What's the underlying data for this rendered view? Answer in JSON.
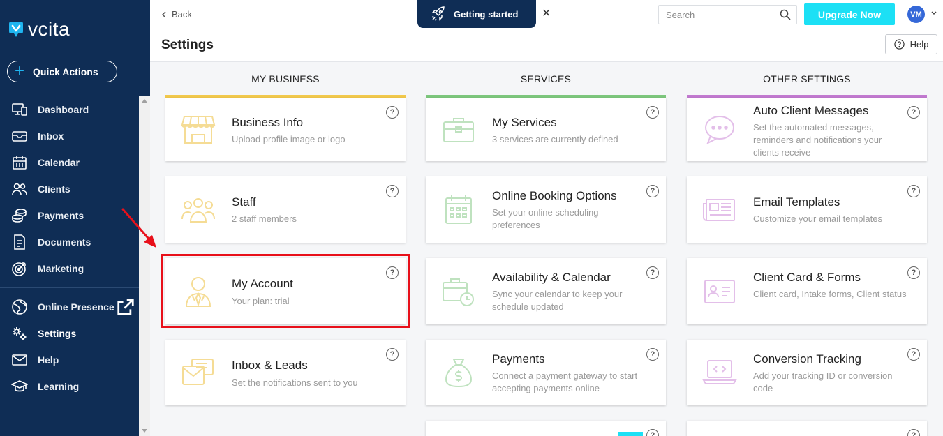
{
  "brand": {
    "name": "vcita",
    "accent": "#1fb5f0",
    "sidebar_bg": "#0f2d55"
  },
  "quick_actions": {
    "label": "Quick Actions"
  },
  "nav": {
    "items": [
      {
        "label": "Dashboard",
        "icon": "dashboard-icon"
      },
      {
        "label": "Inbox",
        "icon": "inbox-icon"
      },
      {
        "label": "Calendar",
        "icon": "calendar-icon"
      },
      {
        "label": "Clients",
        "icon": "clients-icon"
      },
      {
        "label": "Payments",
        "icon": "payments-icon"
      },
      {
        "label": "Documents",
        "icon": "documents-icon"
      },
      {
        "label": "Marketing",
        "icon": "marketing-icon"
      }
    ],
    "bottom_items": [
      {
        "label": "Online Presence",
        "icon": "globe-icon"
      },
      {
        "label": "Settings",
        "icon": "settings-icon",
        "active": true
      },
      {
        "label": "Help",
        "icon": "mail-icon"
      },
      {
        "label": "Learning",
        "icon": "graduation-cap-icon"
      }
    ]
  },
  "topbar": {
    "back_label": "Back",
    "getting_started": "Getting started",
    "close_glyph": "✕",
    "search_placeholder": "Search",
    "upgrade_label": "Upgrade Now",
    "avatar_initials": "VM"
  },
  "page": {
    "title": "Settings",
    "help_label": "Help"
  },
  "columns": [
    {
      "title": "MY BUSINESS",
      "color": "#f2c94c"
    },
    {
      "title": "SERVICES",
      "color": "#7dc77d"
    },
    {
      "title": "OTHER SETTINGS",
      "color": "#c27ad0"
    }
  ],
  "cards": {
    "business_info": {
      "title": "Business Info",
      "sub": "Upload profile image or logo"
    },
    "staff": {
      "title": "Staff",
      "sub": "2 staff members"
    },
    "my_account": {
      "title": "My Account",
      "sub": "Your plan: trial"
    },
    "inbox_leads": {
      "title": "Inbox & Leads",
      "sub": "Set the notifications sent to you"
    },
    "my_services": {
      "title": "My Services",
      "sub": "3 services are currently defined"
    },
    "online_booking": {
      "title": "Online Booking Options",
      "sub": "Set your online scheduling preferences"
    },
    "availability": {
      "title": "Availability & Calendar",
      "sub": "Sync your calendar to keep your schedule updated"
    },
    "payments": {
      "title": "Payments",
      "sub": "Connect a payment gateway to start accepting payments online"
    },
    "auto_messages": {
      "title": "Auto Client Messages",
      "sub": "Set the automated messages, reminders and notifications your clients receive"
    },
    "email_templates": {
      "title": "Email Templates",
      "sub": "Customize your email templates"
    },
    "client_card": {
      "title": "Client Card & Forms",
      "sub": "Client card, Intake forms, Client status"
    },
    "conversion": {
      "title": "Conversion Tracking",
      "sub": "Add your tracking ID or conversion code"
    }
  },
  "help_glyph": "?"
}
